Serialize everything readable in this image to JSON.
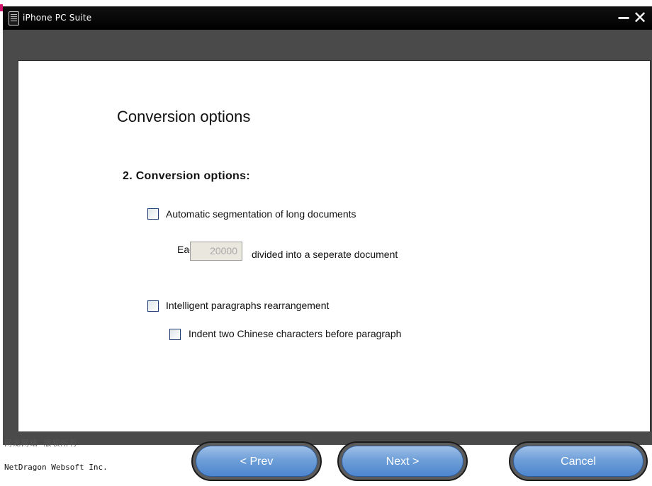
{
  "window": {
    "title": "iPhone PC Suite",
    "minimize_label": "−",
    "close_label": "✕"
  },
  "page": {
    "heading": "Conversion options",
    "section_title": "2. Conversion options:"
  },
  "options": {
    "auto_segment": {
      "label": "Automatic segmentation of long documents",
      "checked": false
    },
    "segment_prefix": "Eac",
    "segment_size": "20000",
    "segment_suffix": "divided into a seperate document",
    "paragraph_rearrange": {
      "label": "Intelligent paragraphs rearrangement",
      "checked": false
    },
    "indent_chinese": {
      "label": "Indent two Chinese characters before paragraph",
      "checked": false
    }
  },
  "footer": {
    "company_cn": "网龙网络 版权所有",
    "company_en": "NetDragon Websoft Inc.",
    "prev_label": "< Prev",
    "next_label": "Next >",
    "cancel_label": "Cancel"
  },
  "colors": {
    "title_bar": "#000000",
    "chrome": "#4a4a4a",
    "button_blue": "#6e9fd8",
    "accent_pink": "#d1136d"
  }
}
